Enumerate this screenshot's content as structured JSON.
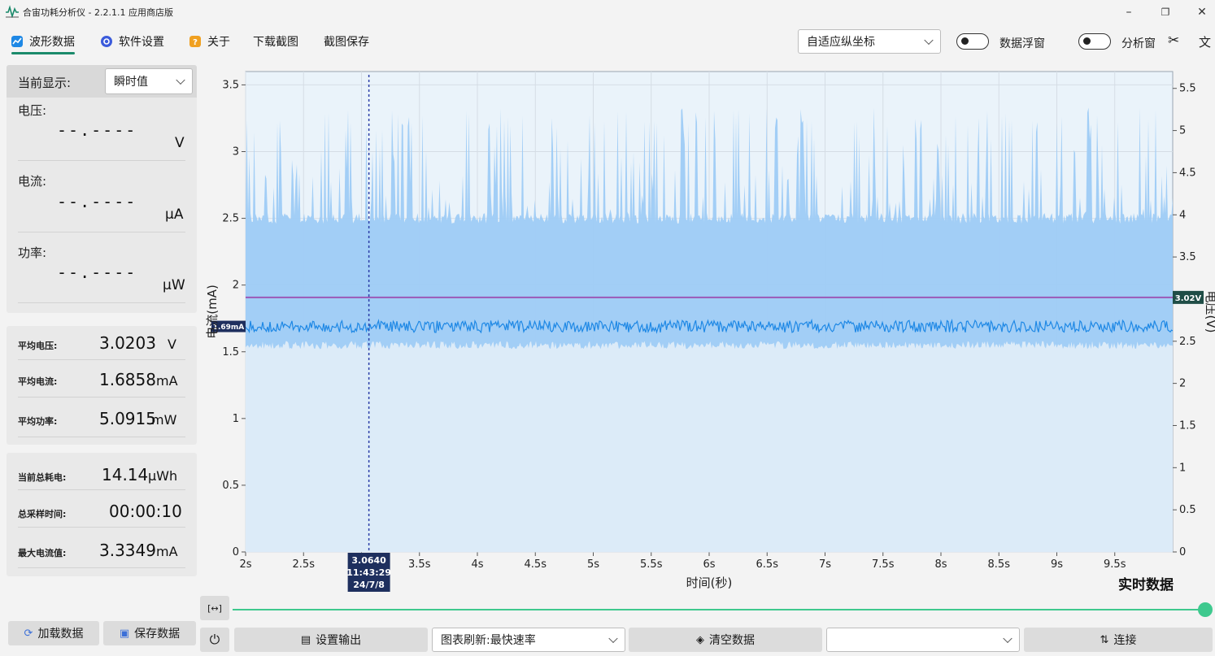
{
  "window": {
    "title": "合宙功耗分析仪 - 2.2.1.1 应用商店版",
    "minimize": "–",
    "maximize": "❐",
    "close": "✕"
  },
  "menu": {
    "waveform": "波形数据",
    "settings": "软件设置",
    "about": "关于",
    "download_screenshot": "下载截图",
    "screenshot_save": "截图保存",
    "axis_mode": "自适应纵坐标",
    "data_float": "数据浮窗",
    "analysis_window": "分析窗",
    "scissor": "✂",
    "translate": "文"
  },
  "current_display": {
    "label": "当前显示:",
    "mode": "瞬时值"
  },
  "measurements": {
    "voltage_label": "电压:",
    "voltage_value": "--.----",
    "voltage_unit": "V",
    "current_label": "电流:",
    "current_value": "--.----",
    "current_unit": "μA",
    "power_label": "功率:",
    "power_value": "--.----",
    "power_unit": "μW"
  },
  "averages": {
    "avg_voltage_label": "平均电压:",
    "avg_voltage_value": "3.0203",
    "avg_voltage_unit": "V",
    "avg_current_label": "平均电流:",
    "avg_current_value": "1.6858",
    "avg_current_unit": "mA",
    "avg_power_label": "平均功率:",
    "avg_power_value": "5.0915",
    "avg_power_unit": "mW"
  },
  "totals": {
    "energy_label": "当前总耗电:",
    "energy_value": "14.14",
    "energy_unit": "μWh",
    "time_label": "总采样时间:",
    "time_value": "00:00:10",
    "max_current_label": "最大电流值:",
    "max_current_value": "3.3349",
    "max_current_unit": "mA"
  },
  "left_buttons": {
    "load": "加载数据",
    "save": "保存数据"
  },
  "bottom_bar": {
    "power_icon": "⏻",
    "setup_output": "设置输出",
    "refresh": "图表刷新:最快速率",
    "clear": "清空数据",
    "port": "",
    "connect": "连接",
    "fit_icon": "[↔]"
  },
  "chart_data": {
    "type": "area",
    "xlabel": "时间(秒)",
    "ylabel_left": "电流(mA)",
    "ylabel_right": "电压(V)",
    "x_range": [
      2,
      10
    ],
    "x_ticks": [
      "2s",
      "2.5s",
      "3s",
      "3.5s",
      "4s",
      "4.5s",
      "5s",
      "5.5s",
      "6s",
      "6.5s",
      "7s",
      "7.5s",
      "8s",
      "8.5s",
      "9s",
      "9.5s"
    ],
    "x_tick_values": [
      2,
      2.5,
      3,
      3.5,
      4,
      4.5,
      5,
      5.5,
      6,
      6.5,
      7,
      7.5,
      8,
      8.5,
      9,
      9.5
    ],
    "ylim_left": [
      0,
      3.6
    ],
    "y_ticks_left": [
      "0",
      "0.5",
      "1",
      "1.5",
      "2",
      "2.5",
      "3",
      "3.5"
    ],
    "y_tick_values_left": [
      0,
      0.5,
      1,
      1.5,
      2,
      2.5,
      3,
      3.5
    ],
    "ylim_right": [
      0,
      5.7
    ],
    "y_ticks_right": [
      "0",
      "0.5",
      "1",
      "1.5",
      "2",
      "2.5",
      "3",
      "3.5",
      "4",
      "4.5",
      "5",
      "5.5"
    ],
    "y_tick_values_right": [
      0,
      0.5,
      1,
      1.5,
      2,
      2.5,
      3,
      3.5,
      4,
      4.5,
      5,
      5.5
    ],
    "grid": true,
    "series": [
      {
        "name": "电流",
        "axis": "left",
        "color": "#1e88e5",
        "mean": 1.69,
        "band_low": 1.55,
        "band_high": 2.5,
        "spike_max": 3.33
      },
      {
        "name": "电压",
        "axis": "right",
        "color": "#9b59b6",
        "mean": 3.02
      }
    ],
    "current_marker": "1.69mA",
    "voltage_marker": "3.02V",
    "cursor": {
      "x": 3.064,
      "label_line1": "3.0640",
      "label_line2": "11:43:29",
      "label_line3": "24/7/8"
    },
    "mode_label": "实时数据"
  },
  "colors": {
    "accent": "#1b8a6b",
    "slider": "#3ec98e",
    "current_fill": "#9ecbf5",
    "current_line": "#1e88e5",
    "voltage_line": "#9b59b6",
    "marker_bg": "#1e2f5e"
  }
}
